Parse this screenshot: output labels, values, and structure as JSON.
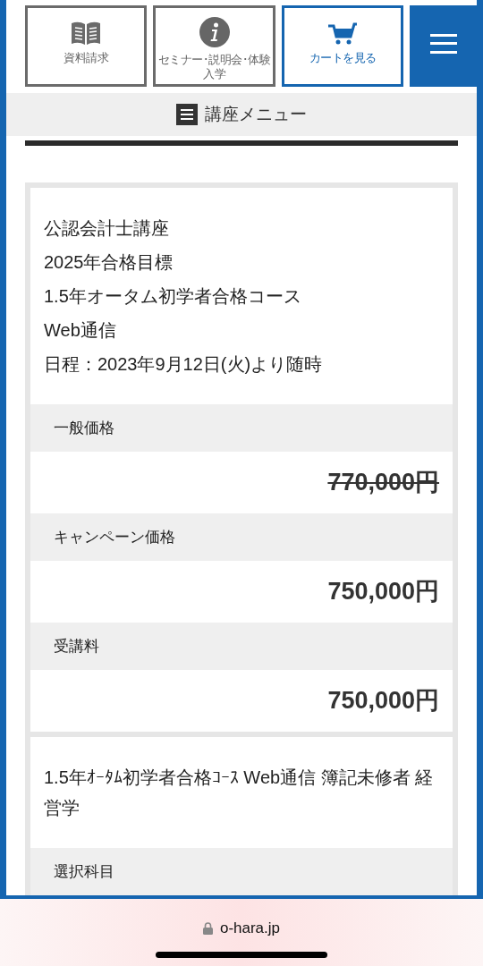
{
  "nav": [
    {
      "kind": "book",
      "label": "資料請求"
    },
    {
      "kind": "info",
      "label": "セミナー･説明会･体験入学"
    },
    {
      "kind": "cart",
      "label": "カートを見る"
    },
    {
      "kind": "menu"
    }
  ],
  "course_menu": {
    "label": "講座メニュー"
  },
  "courses": [
    {
      "title_lines": [
        "公認会計士講座",
        "2025年合格目標",
        "1.5年オータム初学者合格コース",
        "Web通信",
        "日程：2023年9月12日(火)より随時"
      ],
      "rows": [
        {
          "label": "一般価格",
          "value": "770,000円",
          "struck": true
        },
        {
          "label": "キャンペーン価格",
          "value": "750,000円",
          "struck": false
        },
        {
          "label": "受講料",
          "value": "750,000円",
          "struck": false
        }
      ]
    },
    {
      "title_lines": [
        "1.5年ｵｰﾀﾑ初学者合格ｺｰｽ Web通信 簿記未修者 経営学"
      ],
      "rows": [
        {
          "label": "選択科目"
        }
      ]
    }
  ],
  "browser": {
    "url": "o-hara.jp"
  }
}
